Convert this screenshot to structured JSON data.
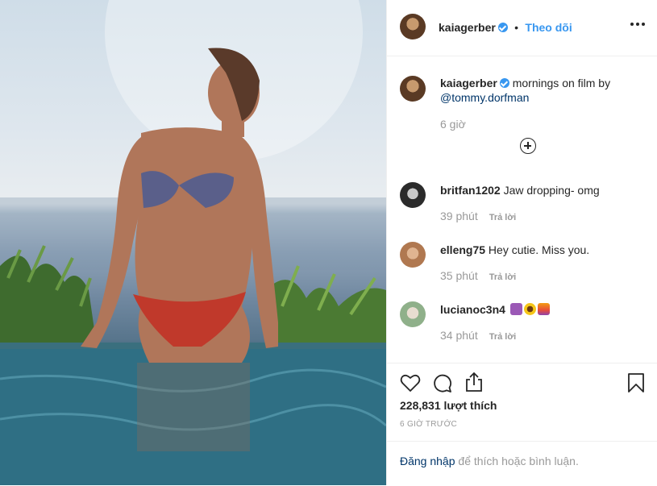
{
  "post": {
    "author": "kaiagerber",
    "follow_label": "Theo dõi",
    "caption": "mornings on film by",
    "caption_mention": "@tommy.dorfman",
    "caption_time": "6 giờ"
  },
  "comments": [
    {
      "user": "britfan1202",
      "text": "Jaw dropping- omg",
      "time": "39 phút",
      "reply": "Trả lời"
    },
    {
      "user": "elleng75",
      "text": "Hey cutie. Miss you.",
      "time": "35 phút",
      "reply": "Trả lời"
    },
    {
      "user": "lucianoc3n4",
      "text": "",
      "time": "34 phút",
      "reply": "Trả lời"
    }
  ],
  "engagement": {
    "likes": "228,831 lượt thích",
    "posted": "6 GIỜ TRƯỚC"
  },
  "footer": {
    "login_link": "Đăng nhập",
    "login_rest": " để thích hoặc bình luận."
  },
  "icons": {
    "heart": "heart-icon",
    "comment": "comment-icon",
    "share": "share-icon",
    "save": "bookmark-icon"
  },
  "colors": {
    "accent": "#3897f0",
    "link": "#003569",
    "muted": "#999999"
  }
}
